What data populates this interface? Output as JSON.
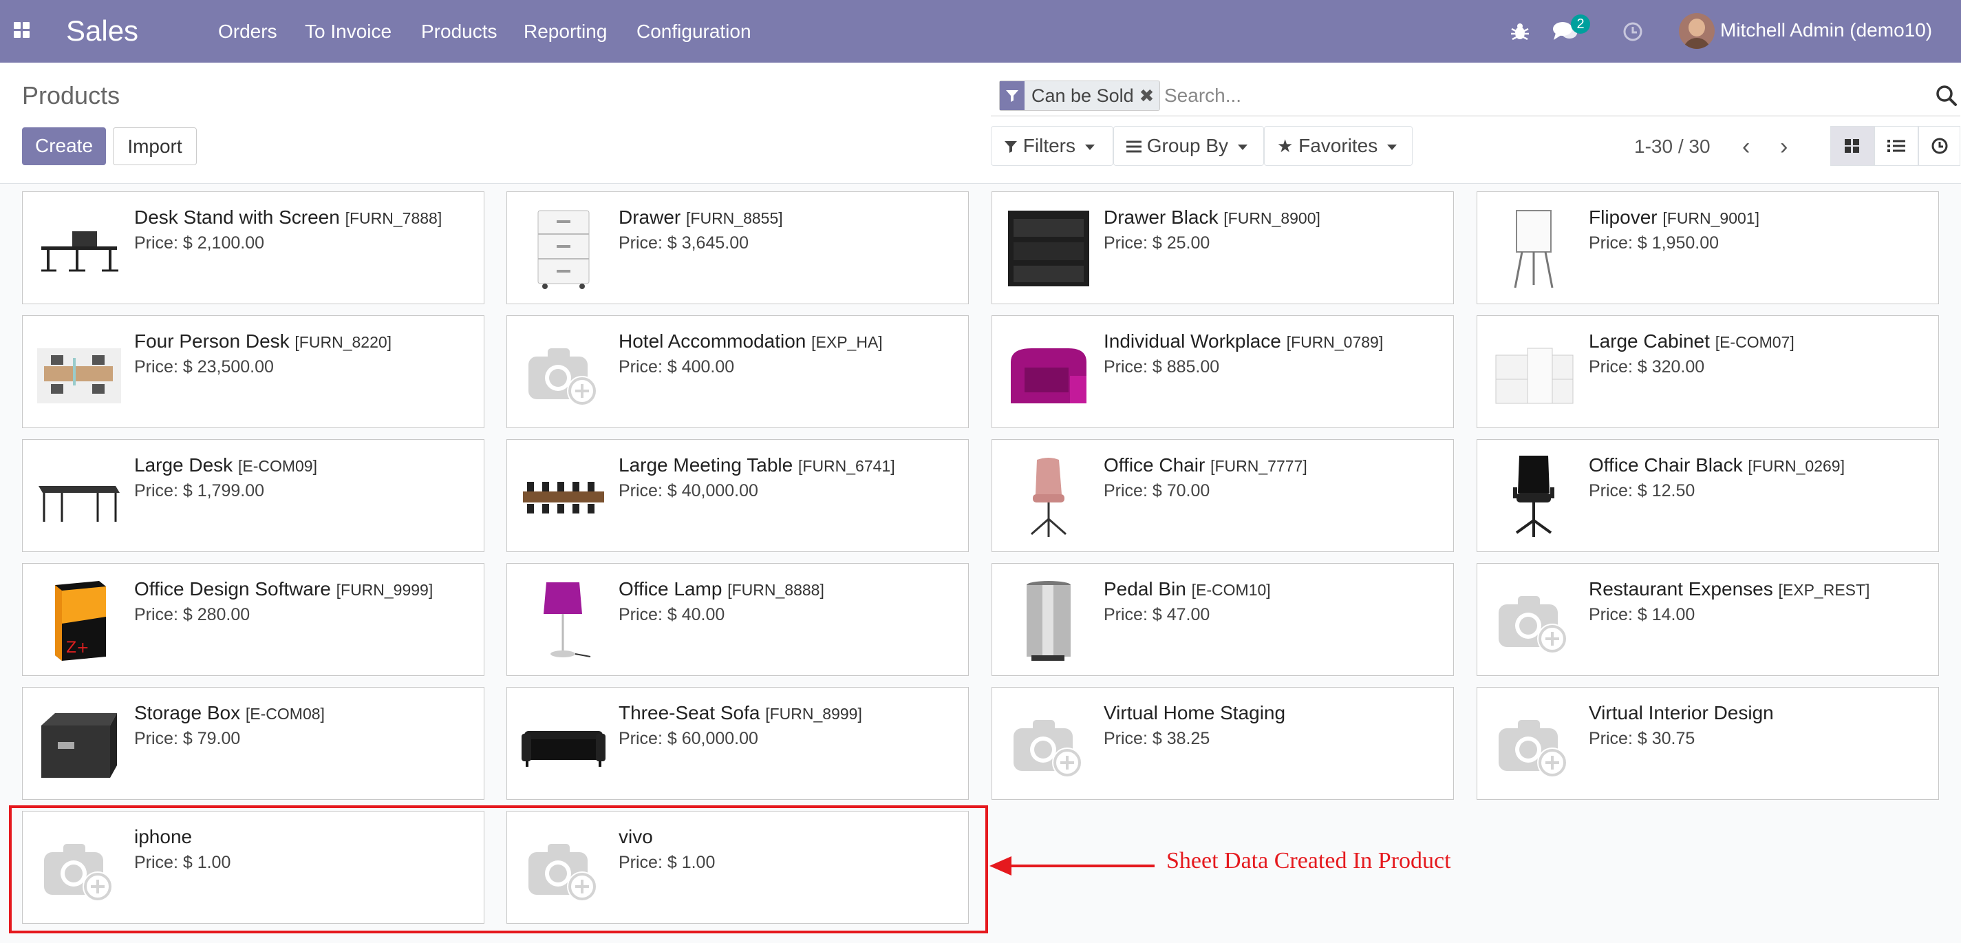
{
  "nav": {
    "app_name": "Sales",
    "menu": [
      "Orders",
      "To Invoice",
      "Products",
      "Reporting",
      "Configuration"
    ],
    "message_count": "2",
    "user": "Mitchell Admin (demo10)",
    "icons": [
      "apps-grid-icon",
      "bug-icon",
      "chat-icon",
      "clock-icon"
    ],
    "accent_color": "#7c7bad"
  },
  "control_panel": {
    "title": "Products",
    "create_label": "Create",
    "import_label": "Import",
    "filter_facet": "Can be Sold",
    "search_placeholder": "Search...",
    "filters_label": "Filters",
    "group_by_label": "Group By",
    "favorites_label": "Favorites",
    "pager": "1-30 / 30",
    "active_view": "kanban"
  },
  "products": [
    {
      "name": "Desk Stand with Screen",
      "ref": "[FURN_7888]",
      "price": "Price: $ 2,100.00",
      "thumb": "desk-stand"
    },
    {
      "name": "Drawer",
      "ref": "[FURN_8855]",
      "price": "Price: $ 3,645.00",
      "thumb": "drawer-white"
    },
    {
      "name": "Drawer Black",
      "ref": "[FURN_8900]",
      "price": "Price: $ 25.00",
      "thumb": "drawer-black"
    },
    {
      "name": "Flipover",
      "ref": "[FURN_9001]",
      "price": "Price: $ 1,950.00",
      "thumb": "flipover"
    },
    {
      "name": "Four Person Desk",
      "ref": "[FURN_8220]",
      "price": "Price: $ 23,500.00",
      "thumb": "four-person-desk"
    },
    {
      "name": "Hotel Accommodation",
      "ref": "[EXP_HA]",
      "price": "Price: $ 400.00",
      "thumb": "placeholder"
    },
    {
      "name": "Individual Workplace",
      "ref": "[FURN_0789]",
      "price": "Price: $ 885.00",
      "thumb": "individual-workplace"
    },
    {
      "name": "Large Cabinet",
      "ref": "[E-COM07]",
      "price": "Price: $ 320.00",
      "thumb": "large-cabinet"
    },
    {
      "name": "Large Desk",
      "ref": "[E-COM09]",
      "price": "Price: $ 1,799.00",
      "thumb": "large-desk"
    },
    {
      "name": "Large Meeting Table",
      "ref": "[FURN_6741]",
      "price": "Price: $ 40,000.00",
      "thumb": "meeting-table"
    },
    {
      "name": "Office Chair",
      "ref": "[FURN_7777]",
      "price": "Price: $ 70.00",
      "thumb": "office-chair"
    },
    {
      "name": "Office Chair Black",
      "ref": "[FURN_0269]",
      "price": "Price: $ 12.50",
      "thumb": "office-chair-black"
    },
    {
      "name": "Office Design Software",
      "ref": "[FURN_9999]",
      "price": "Price: $ 280.00",
      "thumb": "software-box"
    },
    {
      "name": "Office Lamp",
      "ref": "[FURN_8888]",
      "price": "Price: $ 40.00",
      "thumb": "office-lamp"
    },
    {
      "name": "Pedal Bin",
      "ref": "[E-COM10]",
      "price": "Price: $ 47.00",
      "thumb": "pedal-bin"
    },
    {
      "name": "Restaurant Expenses",
      "ref": "[EXP_REST]",
      "price": "Price: $ 14.00",
      "thumb": "placeholder"
    },
    {
      "name": "Storage Box",
      "ref": "[E-COM08]",
      "price": "Price: $ 79.00",
      "thumb": "storage-box"
    },
    {
      "name": "Three-Seat Sofa",
      "ref": "[FURN_8999]",
      "price": "Price: $ 60,000.00",
      "thumb": "sofa"
    },
    {
      "name": "Virtual Home Staging",
      "ref": "",
      "price": "Price: $ 38.25",
      "thumb": "placeholder"
    },
    {
      "name": "Virtual Interior Design",
      "ref": "",
      "price": "Price: $ 30.75",
      "thumb": "placeholder"
    },
    {
      "name": "iphone",
      "ref": "",
      "price": "Price: $ 1.00",
      "thumb": "placeholder"
    },
    {
      "name": "vivo",
      "ref": "",
      "price": "Price: $ 1.00",
      "thumb": "placeholder"
    }
  ],
  "annotation": {
    "text": "Sheet Data Created In Product",
    "color": "#e5191e"
  }
}
